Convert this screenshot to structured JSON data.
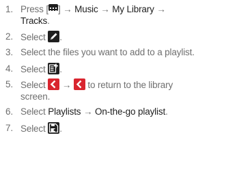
{
  "steps": [
    {
      "num": "1.",
      "t1": "Press [",
      "key_icon": "keypad-grid-icon",
      "t2": "] → ",
      "b1": "Music",
      "t3": " → ",
      "b2": "My Library",
      "t4": " →",
      "b3": "Tracks",
      "t5": "."
    },
    {
      "num": "2.",
      "t1": "Select ",
      "icon": "pencil-edit-icon",
      "t2": "."
    },
    {
      "num": "3.",
      "t1": "Select the files you want to add to a playlist."
    },
    {
      "num": "4.",
      "t1": "Select ",
      "icon": "add-to-list-icon",
      "t2": "."
    },
    {
      "num": "5.",
      "t1": "Select ",
      "icon1": "back-arrow-icon",
      "t2": " → ",
      "icon2": "back-arrow-icon",
      "t3": " to return to the library",
      "t4": "screen."
    },
    {
      "num": "6.",
      "t1": "Select ",
      "b1": "Playlists",
      "t2": " → ",
      "b2": "On-the-go playlist",
      "t3": "."
    },
    {
      "num": "7.",
      "t1": "Select ",
      "icon": "save-icon",
      "t2": "."
    }
  ],
  "colors": {
    "text": "#6f6f6f",
    "emphasis": "#1e1e1e",
    "icon_dark": "#1f1f1f",
    "icon_red": "#d9252f"
  }
}
